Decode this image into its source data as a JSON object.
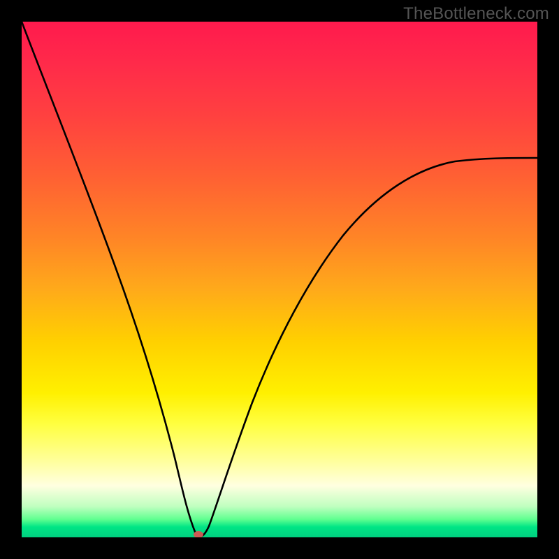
{
  "watermark": "TheBottleneck.com",
  "chart_data": {
    "type": "line",
    "title": "",
    "xlabel": "",
    "ylabel": "",
    "xlim": [
      0,
      100
    ],
    "ylim": [
      0,
      100
    ],
    "series": [
      {
        "name": "bottleneck-curve",
        "x": [
          0,
          4,
          8,
          12,
          16,
          20,
          24,
          28,
          31.5,
          33,
          34,
          36,
          39,
          43,
          48,
          54,
          61,
          69,
          78,
          88,
          100
        ],
        "y": [
          100,
          86,
          72,
          58,
          45,
          33,
          22,
          12,
          4,
          1,
          0,
          2,
          8,
          17,
          28,
          39,
          49,
          57.5,
          64.5,
          70,
          74
        ]
      }
    ],
    "marker": {
      "x": 34,
      "y": 0,
      "color": "#cc5555"
    },
    "gradient_bands": [
      {
        "pos": 0,
        "color": "#ff1a4d",
        "meaning": "worst"
      },
      {
        "pos": 50,
        "color": "#ffaa1a",
        "meaning": "mid"
      },
      {
        "pos": 100,
        "color": "#00d080",
        "meaning": "best"
      }
    ]
  }
}
